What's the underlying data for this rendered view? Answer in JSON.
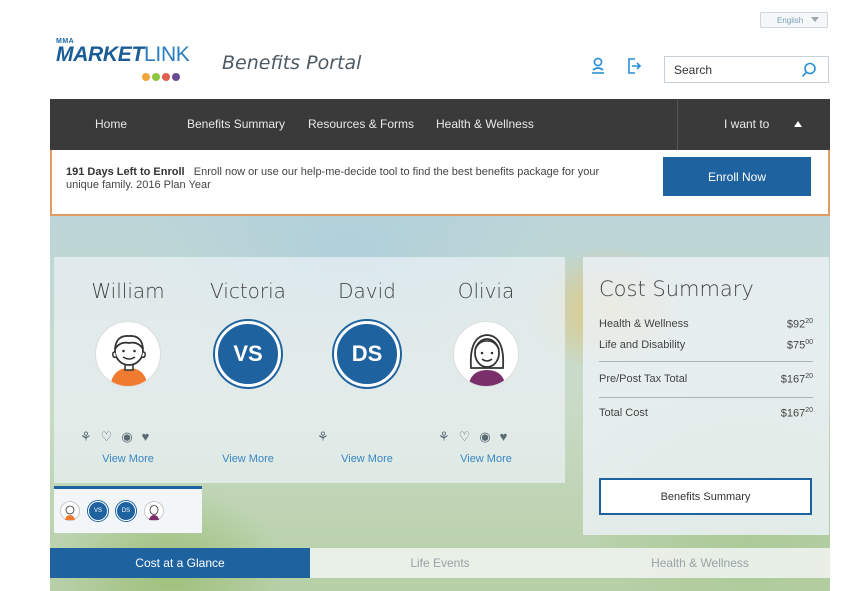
{
  "header": {
    "language": "English",
    "logo_top": "MMA",
    "logo_word": "MARKET",
    "logo_link": "LINK",
    "portal_title": "Benefits Portal",
    "search_placeholder": "Search"
  },
  "nav": {
    "items": [
      "Home",
      "Benefits Summary",
      "Resources & Forms",
      "Health & Wellness"
    ],
    "i_want_to": "I want to"
  },
  "banner": {
    "days_left": "191 Days Left to Enroll",
    "message": "Enroll now or use our help-me-decide tool to find the best benefits package for your unique family. 2016 Plan Year",
    "button": "Enroll Now"
  },
  "family": {
    "members": [
      {
        "name": "William",
        "initials": "",
        "view_more": "View More"
      },
      {
        "name": "Victoria",
        "initials": "VS",
        "view_more": "View More"
      },
      {
        "name": "David",
        "initials": "DS",
        "view_more": "View More"
      },
      {
        "name": "Olivia",
        "initials": "",
        "view_more": "View More"
      }
    ],
    "thumb_initials": [
      "VS",
      "DS"
    ]
  },
  "cost_summary": {
    "title": "Cost Summary",
    "rows": [
      {
        "label": "Health & Wellness",
        "dollars": "$92",
        "cents": "20"
      },
      {
        "label": "Life and Disability",
        "dollars": "$75",
        "cents": "00"
      },
      {
        "label": "Pre/Post Tax Total",
        "dollars": "$167",
        "cents": "20"
      },
      {
        "label": "Total Cost",
        "dollars": "$167",
        "cents": "20"
      }
    ],
    "button": "Benefits Summary"
  },
  "tabs": [
    "Cost at a Glance",
    "Life Events",
    "Health & Wellness"
  ],
  "colors": {
    "primary": "#1f62a0",
    "nav_bg": "#3a3a3a",
    "banner_border": "#e39a63",
    "link": "#3a86c4"
  }
}
